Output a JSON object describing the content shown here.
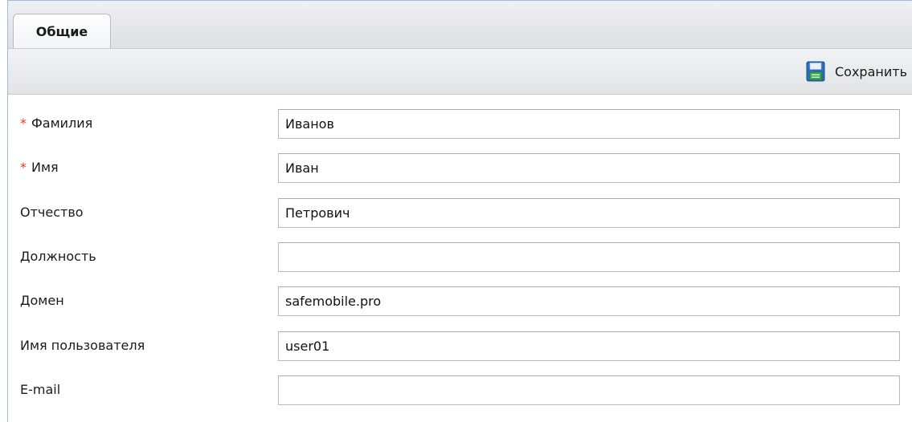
{
  "tabs": [
    {
      "label": "Общие",
      "active": true
    }
  ],
  "toolbar": {
    "save_label": "Сохранить",
    "save_icon": "floppy-disk-icon"
  },
  "form": {
    "required_marker": "*",
    "fields": [
      {
        "key": "last_name",
        "label": "Фамилия",
        "required": true,
        "value": ""
      },
      {
        "key": "first_name",
        "label": "Имя",
        "required": true,
        "value": ""
      },
      {
        "key": "middle_name",
        "label": "Отчество",
        "required": false,
        "value": ""
      },
      {
        "key": "position",
        "label": "Должность",
        "required": false,
        "value": ""
      },
      {
        "key": "domain",
        "label": "Домен",
        "required": false,
        "value": ""
      },
      {
        "key": "username",
        "label": "Имя пользователя",
        "required": false,
        "value": ""
      },
      {
        "key": "email",
        "label": "E-mail",
        "required": false,
        "value": ""
      }
    ],
    "values": {
      "last_name": "Иванов",
      "first_name": "Иван",
      "middle_name": "Петрович",
      "position": "",
      "domain": "safemobile.pro",
      "username": "user01",
      "email": ""
    }
  },
  "colors": {
    "required_marker": "#e23a2c",
    "panel_border": "#99bbe8",
    "field_border": "#b5b8c8",
    "icon_blue": "#2b6cb8",
    "icon_green": "#3aa64a"
  }
}
